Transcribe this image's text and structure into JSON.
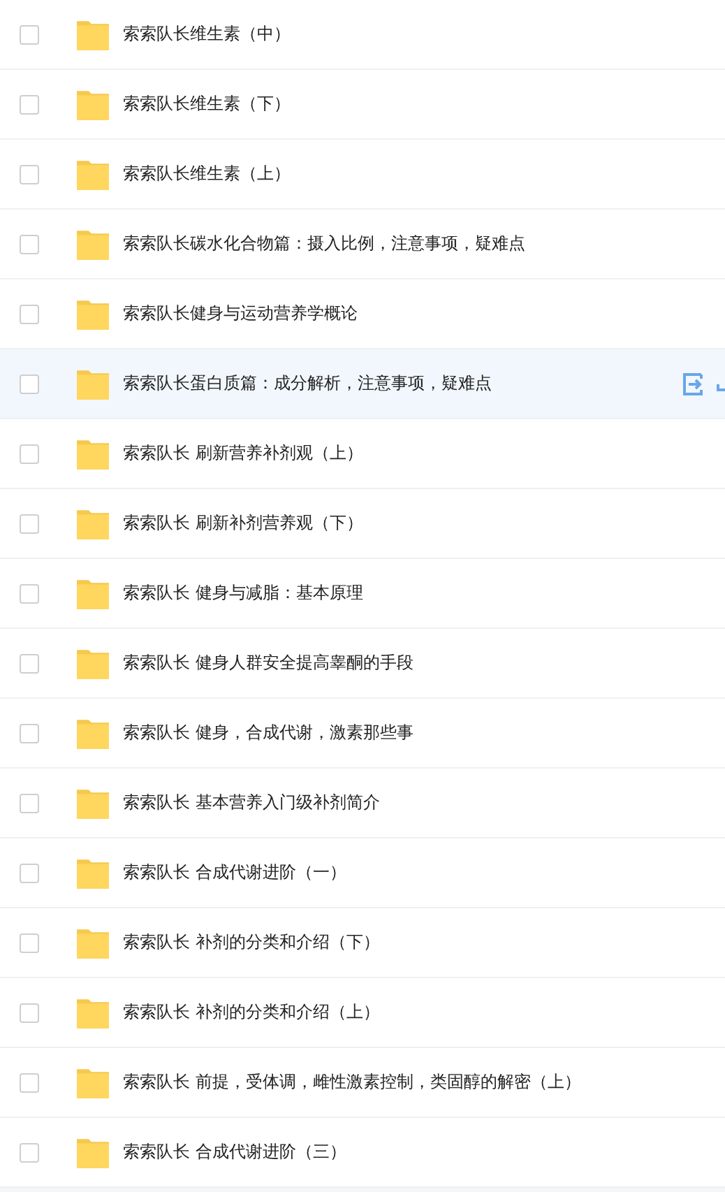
{
  "files": [
    {
      "name": "索索队长维生素（中）",
      "checked": false,
      "hovered": false
    },
    {
      "name": "索索队长维生素（下）",
      "checked": false,
      "hovered": false
    },
    {
      "name": "索索队长维生素（上）",
      "checked": false,
      "hovered": false
    },
    {
      "name": "索索队长碳水化合物篇：摄入比例，注意事项，疑难点",
      "checked": false,
      "hovered": false
    },
    {
      "name": "索索队长健身与运动营养学概论",
      "checked": false,
      "hovered": false
    },
    {
      "name": "索索队长蛋白质篇：成分解析，注意事项，疑难点",
      "checked": false,
      "hovered": true
    },
    {
      "name": "索索队长 刷新营养补剂观（上）",
      "checked": false,
      "hovered": false
    },
    {
      "name": "索索队长 刷新补剂营养观（下）",
      "checked": false,
      "hovered": false
    },
    {
      "name": "索索队长 健身与减脂：基本原理",
      "checked": false,
      "hovered": false
    },
    {
      "name": "索索队长 健身人群安全提高睾酮的手段",
      "checked": false,
      "hovered": false
    },
    {
      "name": "索索队长 健身，合成代谢，激素那些事",
      "checked": false,
      "hovered": false
    },
    {
      "name": "索索队长 基本营养入门级补剂简介",
      "checked": false,
      "hovered": false
    },
    {
      "name": "索索队长 合成代谢进阶（一）",
      "checked": false,
      "hovered": false
    },
    {
      "name": "索索队长 补剂的分类和介绍（下）",
      "checked": false,
      "hovered": false
    },
    {
      "name": "索索队长 补剂的分类和介绍（上）",
      "checked": false,
      "hovered": false
    },
    {
      "name": "索索队长 前提，受体调，雌性激素控制，类固醇的解密（上）",
      "checked": false,
      "hovered": false
    },
    {
      "name": "索索队长 合成代谢进阶（三）",
      "checked": false,
      "hovered": false
    }
  ]
}
